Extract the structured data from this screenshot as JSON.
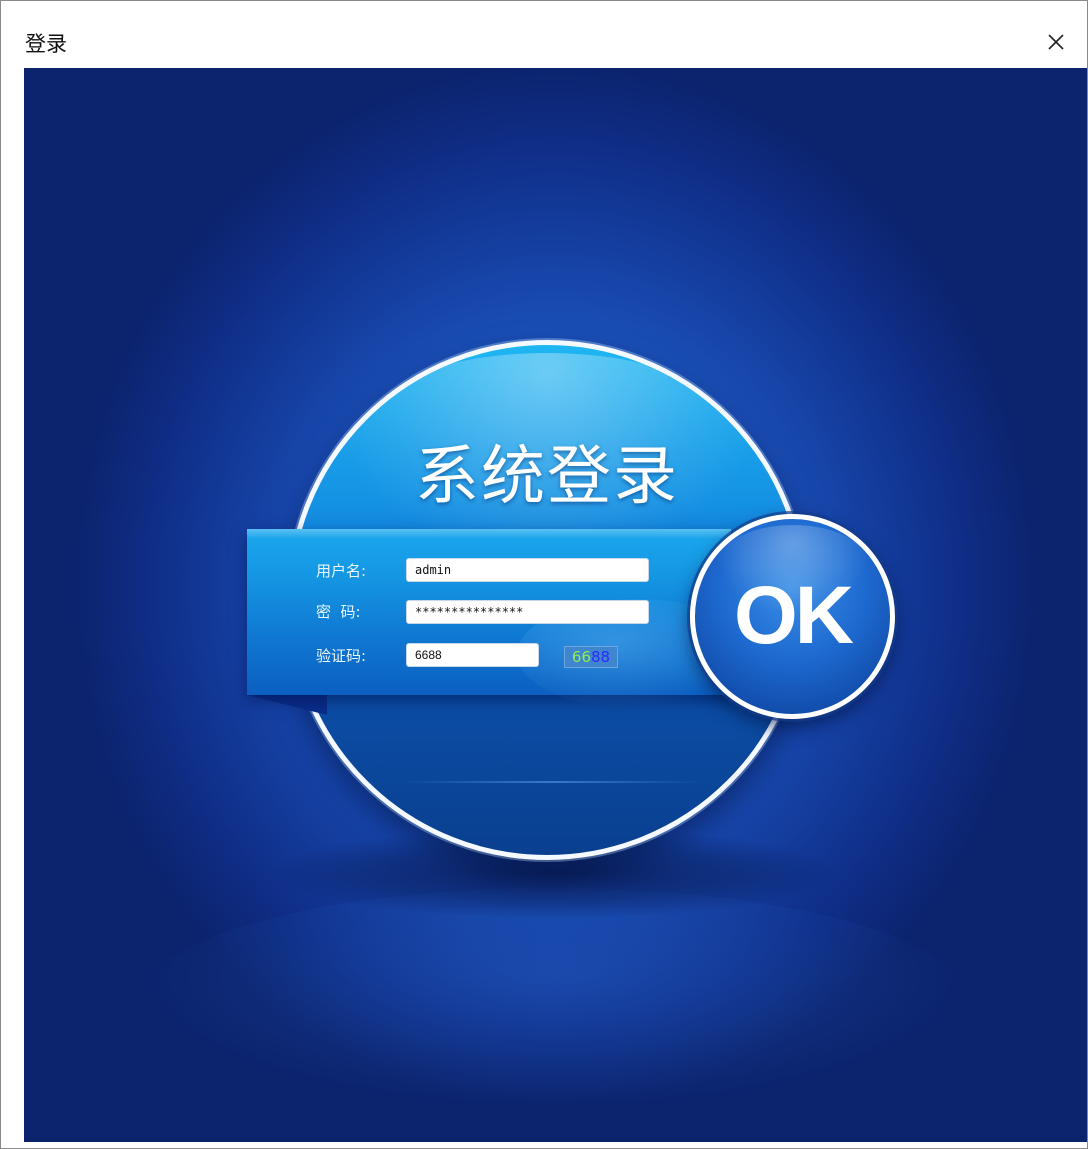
{
  "window": {
    "title": "登录"
  },
  "login": {
    "heading": "系统登录",
    "username_label": "用户名:",
    "username_value": "admin",
    "password_label": "密  码:",
    "password_value": "***************",
    "captcha_label": "验证码:",
    "captcha_input_value": "6688",
    "captcha_image_text_a": "66",
    "captcha_image_text_b": "88",
    "ok_label": "OK"
  },
  "colors": {
    "background": "#1f5ac4",
    "panel": "#1595e2",
    "ok_button": "#1e6ad0",
    "captcha_digits_a": "#8df04a",
    "captcha_digits_b": "#2b2bff"
  },
  "icons": {
    "close": "close-icon"
  }
}
